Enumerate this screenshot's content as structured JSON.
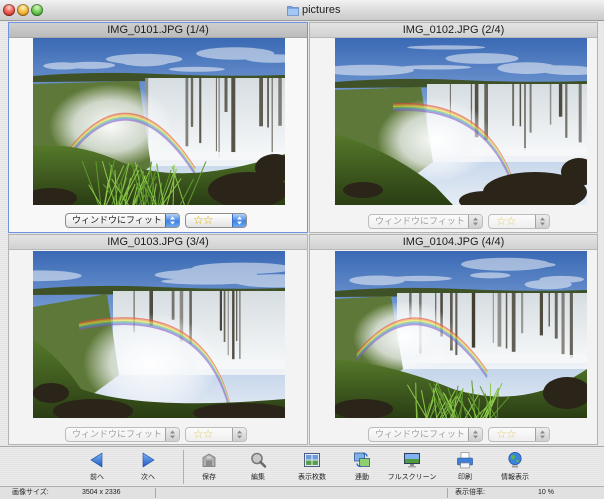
{
  "window": {
    "title": "pictures",
    "title_icon": "folder-icon",
    "controls": [
      "close-button",
      "minimize-button",
      "zoom-button"
    ]
  },
  "panes": [
    {
      "caption": "IMG_0101.JPG (1/4)",
      "fit_label": "ウィンドウにフィット",
      "rating": "☆☆",
      "selected": true
    },
    {
      "caption": "IMG_0102.JPG (2/4)",
      "fit_label": "ウィンドウにフィット",
      "rating": "☆☆",
      "selected": false
    },
    {
      "caption": "IMG_0103.JPG (3/4)",
      "fit_label": "ウィンドウにフィット",
      "rating": "☆☆",
      "selected": false
    },
    {
      "caption": "IMG_0104.JPG (4/4)",
      "fit_label": "ウィンドウにフィット",
      "rating": "☆☆",
      "selected": false
    }
  ],
  "toolbar": {
    "items": [
      {
        "label": "前へ",
        "icon": "previous-arrow-icon"
      },
      {
        "label": "次へ",
        "icon": "next-arrow-icon"
      },
      {
        "label": "保存",
        "icon": "save-icon"
      },
      {
        "label": "編集",
        "icon": "edit-icon"
      },
      {
        "label": "表示枚数",
        "icon": "grid-layout-icon"
      },
      {
        "label": "連動",
        "icon": "sync-link-icon"
      },
      {
        "label": "フルスクリーン",
        "icon": "fullscreen-icon"
      },
      {
        "label": "印刷",
        "icon": "print-icon"
      },
      {
        "label": "情報表示",
        "icon": "info-globe-icon"
      }
    ]
  },
  "status": {
    "size_label": "画像サイズ:",
    "size_value": "3504 x 2336",
    "zoom_label": "表示倍率:",
    "zoom_value": "10 %"
  },
  "colors": {
    "selection_border": "#6e92e4",
    "toolbar_blue": "#2f6fd0",
    "rating_star": "#d9aa00",
    "close": "#e0443b",
    "minimize": "#f3b33c",
    "zoom": "#56bb43"
  }
}
